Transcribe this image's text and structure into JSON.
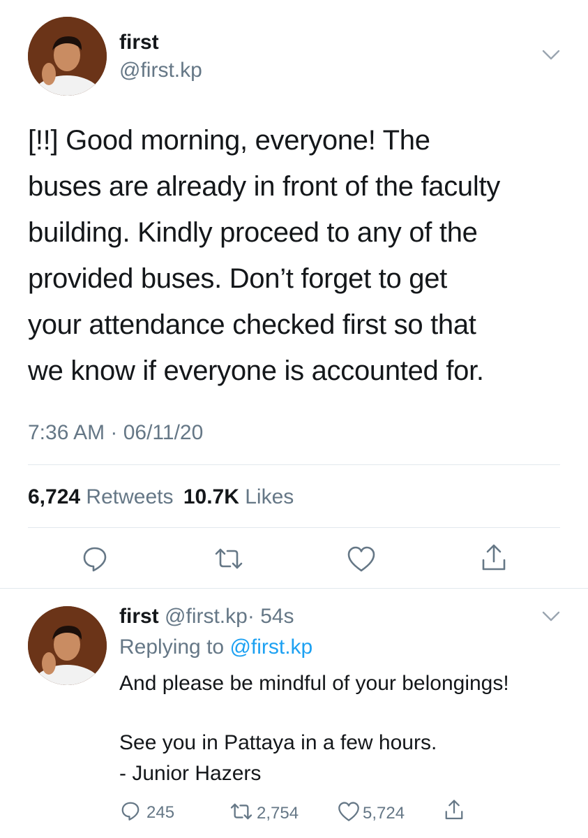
{
  "colors": {
    "text": "#14171a",
    "secondary": "#657786",
    "link": "#1da1f2",
    "divider": "#e1e8ed"
  },
  "main_tweet": {
    "author_name": "first",
    "author_handle": "@first.kp",
    "avatar": "profile-photo",
    "menu_icon": "chevron-down-icon",
    "text": "[!!] Good morning, everyone! The\nbuses are already in front of the faculty\nbuilding. Kindly proceed to any of the\nprovided buses. Don’t forget to get\nyour attendance checked first so that\nwe know if everyone is accounted for.",
    "timestamp": "7:36 AM · 06/11/20",
    "retweets_count": "6,724",
    "retweets_label": "Retweets",
    "likes_count": "10.7K",
    "likes_label": "Likes",
    "actions": [
      "reply-icon",
      "retweet-icon",
      "like-icon",
      "share-icon"
    ]
  },
  "reply_tweet": {
    "author_name": "first",
    "author_handle": "@first.kp",
    "time_sep": "·",
    "time": "54s",
    "replying_prefix": "Replying to",
    "replying_handle": "@first.kp",
    "line1": "And please be mindful of your belongings!",
    "line2": "See you in Pattaya in a few hours.",
    "line3": "- Junior Hazers",
    "reply_count": "245",
    "retweet_count": "2,754",
    "like_count": "5,724"
  }
}
